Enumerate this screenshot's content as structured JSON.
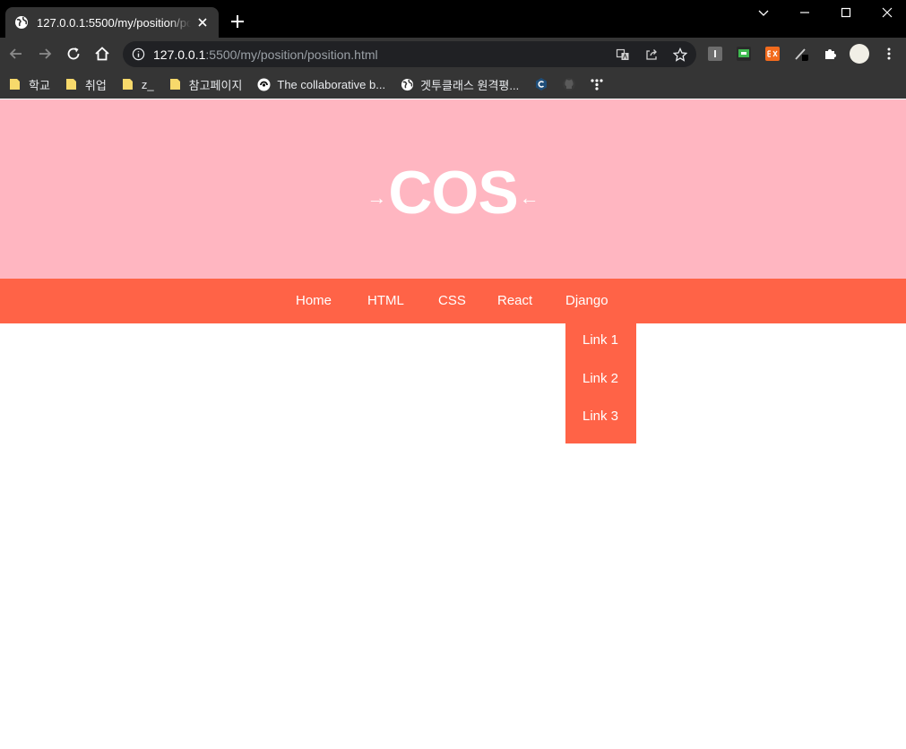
{
  "browser": {
    "tab_title": "127.0.0.1:5500/my/position/position.html",
    "url_host": "127.0.0.1",
    "url_path": ":5500/my/position/position.html",
    "colors": {
      "frame": "#000000",
      "toolbar": "#353535",
      "omnibox": "#202124"
    }
  },
  "bookmarks": [
    {
      "label": "학교",
      "icon": "folder-icon"
    },
    {
      "label": "취업",
      "icon": "folder-icon"
    },
    {
      "label": "z_",
      "icon": "folder-icon"
    },
    {
      "label": "참고페이지",
      "icon": "folder-icon"
    },
    {
      "label": "The collaborative b...",
      "icon": "collab-icon"
    },
    {
      "label": "겟투클래스 원격평...",
      "icon": "globe-icon"
    }
  ],
  "header": {
    "logo": "COS",
    "arrow_left": "→",
    "arrow_right": "←",
    "bg_color": "#ffb6c1"
  },
  "nav": {
    "bg_color": "#ff6347",
    "items": [
      "Home",
      "HTML",
      "CSS",
      "React",
      "Django"
    ],
    "dropdown": [
      "Link 1",
      "Link 2",
      "Link 3"
    ]
  }
}
